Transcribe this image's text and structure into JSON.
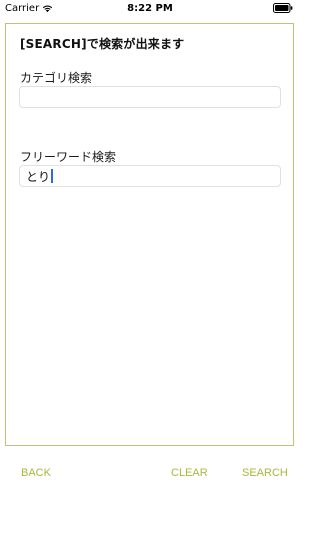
{
  "status_bar": {
    "carrier": "Carrier",
    "time": "8:22 PM",
    "wifi_icon": "wifi-icon",
    "battery_icon": "battery-icon"
  },
  "panel": {
    "title": "[SEARCH]で検索が出来ます",
    "category": {
      "label": "カテゴリ検索",
      "value": ""
    },
    "freeword": {
      "label": "フリーワード検索",
      "value": "とり"
    }
  },
  "actions": {
    "back": "BACK",
    "clear": "CLEAR",
    "search": "SEARCH"
  },
  "colors": {
    "accent": "#a8b83a",
    "panel_border": "#b7c67b",
    "caret": "#2a6ae8"
  }
}
